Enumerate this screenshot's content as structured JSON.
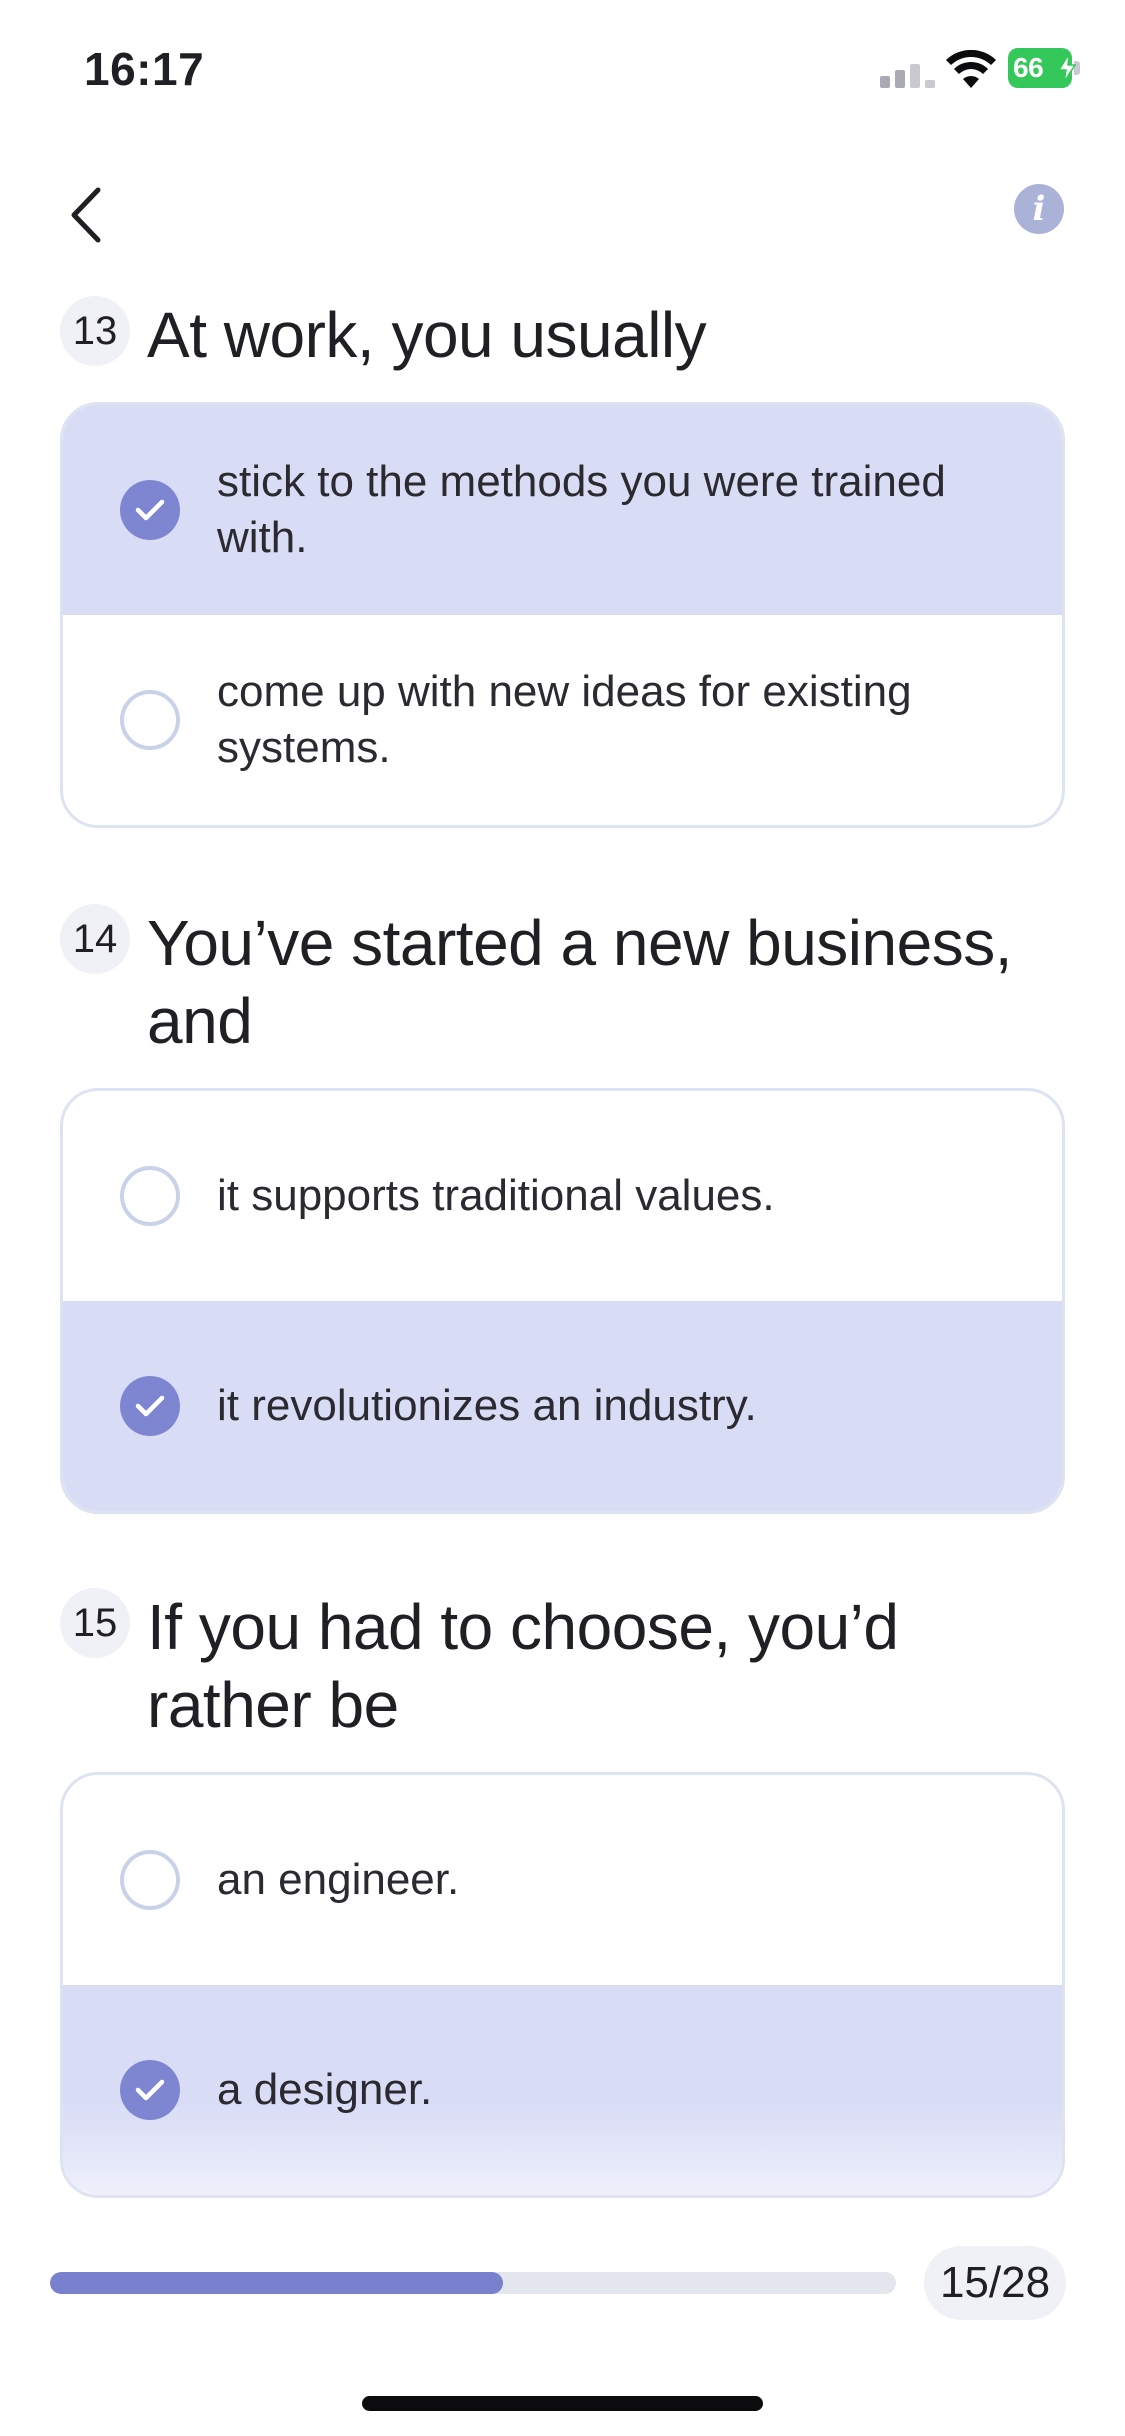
{
  "status_bar": {
    "time": "16:17",
    "battery": "66"
  },
  "nav": {
    "back_icon": "chevron-left-icon",
    "info_icon": "info-icon",
    "info_glyph": "i"
  },
  "questions": [
    {
      "number": "13",
      "title": "At work, you usually",
      "options": [
        {
          "label": "stick to the methods you were trained with.",
          "selected": true
        },
        {
          "label": "come up with new ideas for existing systems.",
          "selected": false
        }
      ]
    },
    {
      "number": "14",
      "title": "You’ve started a new business, and",
      "options": [
        {
          "label": "it supports traditional values.",
          "selected": false
        },
        {
          "label": "it revolutionizes an industry.",
          "selected": true
        }
      ]
    },
    {
      "number": "15",
      "title": "If you had to choose, you’d rather be",
      "options": [
        {
          "label": "an engineer.",
          "selected": false
        },
        {
          "label": "a designer.",
          "selected": true
        }
      ]
    }
  ],
  "progress": {
    "current": 15,
    "total": 28,
    "label": "15/28",
    "fraction": 0.536
  },
  "colors": {
    "accent": "#7980cd",
    "selected_bg": "#d8dcf5",
    "battery": "#34c759"
  }
}
